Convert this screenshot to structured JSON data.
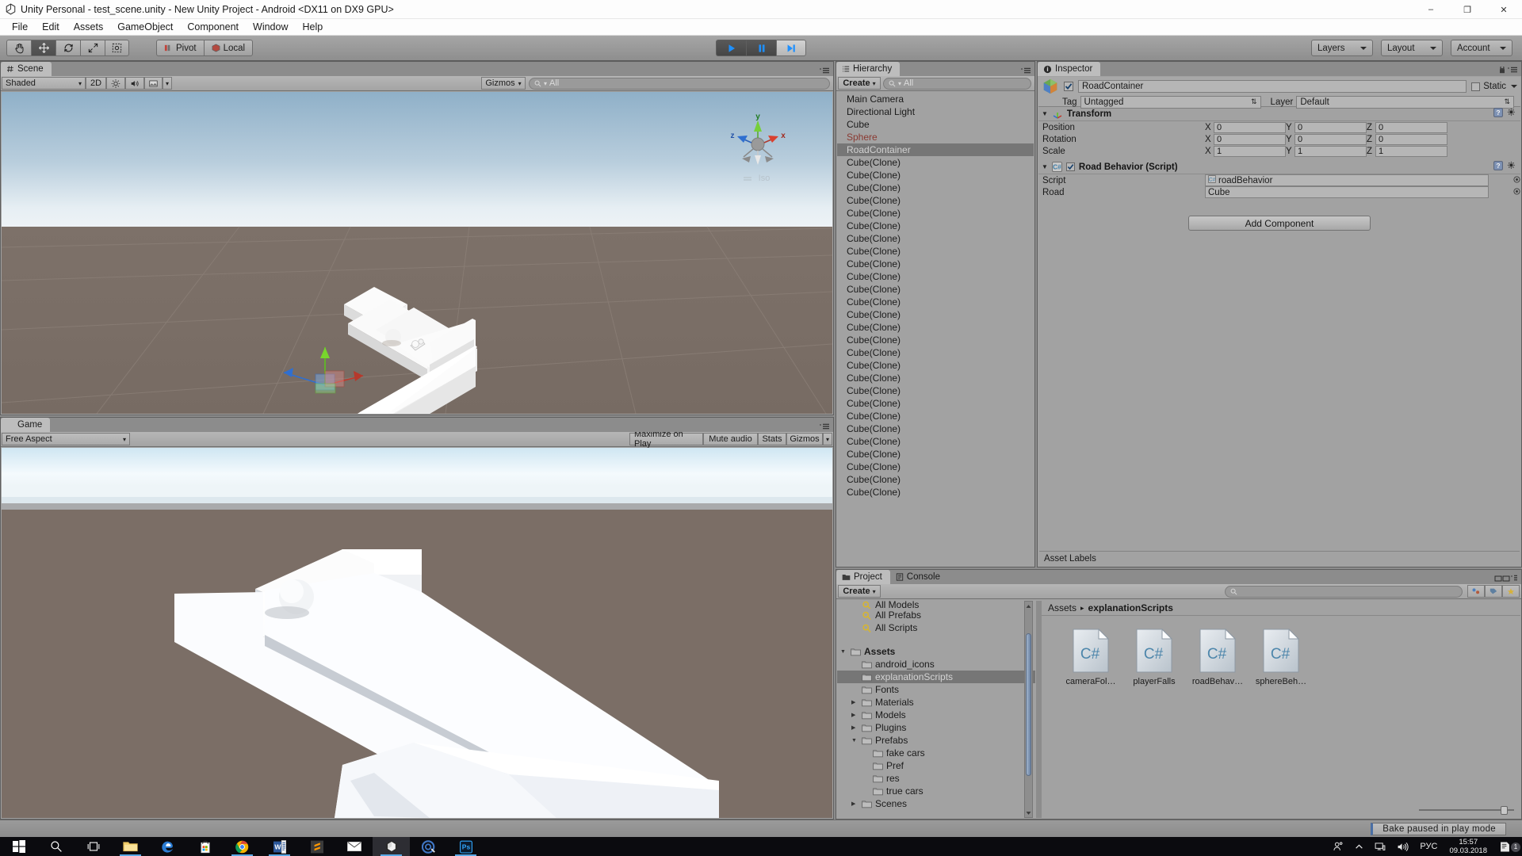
{
  "window": {
    "title": "Unity Personal - test_scene.unity - New Unity Project - Android <DX11 on DX9 GPU>",
    "minimize": "–",
    "maximize": "❐",
    "close": "✕"
  },
  "menu": {
    "items": [
      {
        "label": "File"
      },
      {
        "label": "Edit"
      },
      {
        "label": "Assets"
      },
      {
        "label": "GameObject"
      },
      {
        "label": "Component"
      },
      {
        "label": "Window"
      },
      {
        "label": "Help"
      }
    ]
  },
  "toolbar": {
    "tools": [
      {
        "name": "hand-tool",
        "active": false
      },
      {
        "name": "move-tool",
        "active": true
      },
      {
        "name": "rotate-tool",
        "active": false
      },
      {
        "name": "scale-tool",
        "active": false
      },
      {
        "name": "rect-tool",
        "active": false
      }
    ],
    "pivot_label": "Pivot",
    "local_label": "Local",
    "play_active": true,
    "pause_active": false,
    "step_active": true,
    "layers_label": "Layers",
    "layout_label": "Layout",
    "account_label": "Account"
  },
  "scene": {
    "tab_label": "Scene",
    "shading_mode": "Shaded",
    "mode_2d": "2D",
    "gizmos_label": "Gizmos",
    "search_placeholder": "All",
    "search_value": "All",
    "gizmo": {
      "x_label": "x",
      "y_label": "y",
      "z_label": "z",
      "projection": "Iso"
    }
  },
  "game": {
    "tab_label": "Game",
    "aspect": "Free Aspect",
    "maximize_label": "Maximize on Play",
    "mute_label": "Mute audio",
    "stats_label": "Stats",
    "gizmos_label": "Gizmos"
  },
  "hierarchy": {
    "tab_label": "Hierarchy",
    "create_label": "Create",
    "search_value": "All",
    "items": [
      {
        "label": "Main Camera",
        "state": "normal"
      },
      {
        "label": "Directional Light",
        "state": "normal"
      },
      {
        "label": "Cube",
        "state": "normal"
      },
      {
        "label": "Sphere",
        "state": "missing"
      },
      {
        "label": "RoadContainer",
        "state": "selected"
      },
      {
        "label": "Cube(Clone)",
        "state": "normal"
      },
      {
        "label": "Cube(Clone)",
        "state": "normal"
      },
      {
        "label": "Cube(Clone)",
        "state": "normal"
      },
      {
        "label": "Cube(Clone)",
        "state": "normal"
      },
      {
        "label": "Cube(Clone)",
        "state": "normal"
      },
      {
        "label": "Cube(Clone)",
        "state": "normal"
      },
      {
        "label": "Cube(Clone)",
        "state": "normal"
      },
      {
        "label": "Cube(Clone)",
        "state": "normal"
      },
      {
        "label": "Cube(Clone)",
        "state": "normal"
      },
      {
        "label": "Cube(Clone)",
        "state": "normal"
      },
      {
        "label": "Cube(Clone)",
        "state": "normal"
      },
      {
        "label": "Cube(Clone)",
        "state": "normal"
      },
      {
        "label": "Cube(Clone)",
        "state": "normal"
      },
      {
        "label": "Cube(Clone)",
        "state": "normal"
      },
      {
        "label": "Cube(Clone)",
        "state": "normal"
      },
      {
        "label": "Cube(Clone)",
        "state": "normal"
      },
      {
        "label": "Cube(Clone)",
        "state": "normal"
      },
      {
        "label": "Cube(Clone)",
        "state": "normal"
      },
      {
        "label": "Cube(Clone)",
        "state": "normal"
      },
      {
        "label": "Cube(Clone)",
        "state": "normal"
      },
      {
        "label": "Cube(Clone)",
        "state": "normal"
      },
      {
        "label": "Cube(Clone)",
        "state": "normal"
      },
      {
        "label": "Cube(Clone)",
        "state": "normal"
      },
      {
        "label": "Cube(Clone)",
        "state": "normal"
      },
      {
        "label": "Cube(Clone)",
        "state": "normal"
      },
      {
        "label": "Cube(Clone)",
        "state": "normal"
      },
      {
        "label": "Cube(Clone)",
        "state": "normal"
      }
    ]
  },
  "inspector": {
    "tab_label": "Inspector",
    "object_name": "RoadContainer",
    "enabled": true,
    "static_label": "Static",
    "tag_label": "Tag",
    "tag_value": "Untagged",
    "layer_label": "Layer",
    "layer_value": "Default",
    "transform": {
      "title": "Transform",
      "rows": [
        {
          "label": "Position",
          "x": "0",
          "y": "0",
          "z": "0"
        },
        {
          "label": "Rotation",
          "x": "0",
          "y": "0",
          "z": "0"
        },
        {
          "label": "Scale",
          "x": "1",
          "y": "1",
          "z": "1"
        }
      ],
      "axis_x": "X",
      "axis_y": "Y",
      "axis_z": "Z"
    },
    "script_component": {
      "title": "Road Behavior (Script)",
      "enabled": true,
      "fields": [
        {
          "label": "Script",
          "value": "roadBehavior",
          "kind": "script"
        },
        {
          "label": "Road",
          "value": "Cube",
          "kind": "object"
        }
      ]
    },
    "add_component_label": "Add Component",
    "asset_labels_title": "Asset Labels"
  },
  "project": {
    "tab_label": "Project",
    "console_tab_label": "Console",
    "create_label": "Create",
    "search_value": "",
    "tree": [
      {
        "label": "All Models",
        "indent": 1,
        "type": "search",
        "arrow": "none",
        "selected": false,
        "clipped": true
      },
      {
        "label": "All Prefabs",
        "indent": 1,
        "type": "search",
        "arrow": "none",
        "selected": false
      },
      {
        "label": "All Scripts",
        "indent": 1,
        "type": "search",
        "arrow": "none",
        "selected": false
      },
      {
        "label": "",
        "indent": 0,
        "type": "spacer",
        "arrow": "none",
        "selected": false
      },
      {
        "label": "Assets",
        "indent": 0,
        "type": "folder",
        "arrow": "open",
        "selected": false,
        "bold": true
      },
      {
        "label": "android_icons",
        "indent": 1,
        "type": "folder",
        "arrow": "none",
        "selected": false
      },
      {
        "label": "explanationScripts",
        "indent": 1,
        "type": "folder",
        "arrow": "none",
        "selected": true
      },
      {
        "label": "Fonts",
        "indent": 1,
        "type": "folder",
        "arrow": "none",
        "selected": false
      },
      {
        "label": "Materials",
        "indent": 1,
        "type": "folder",
        "arrow": "closed",
        "selected": false
      },
      {
        "label": "Models",
        "indent": 1,
        "type": "folder",
        "arrow": "closed",
        "selected": false
      },
      {
        "label": "Plugins",
        "indent": 1,
        "type": "folder",
        "arrow": "closed",
        "selected": false
      },
      {
        "label": "Prefabs",
        "indent": 1,
        "type": "folder",
        "arrow": "open",
        "selected": false
      },
      {
        "label": "fake cars",
        "indent": 2,
        "type": "folder",
        "arrow": "none",
        "selected": false
      },
      {
        "label": "Pref",
        "indent": 2,
        "type": "folder",
        "arrow": "none",
        "selected": false
      },
      {
        "label": "res",
        "indent": 2,
        "type": "folder",
        "arrow": "none",
        "selected": false
      },
      {
        "label": "true cars",
        "indent": 2,
        "type": "folder",
        "arrow": "none",
        "selected": false
      },
      {
        "label": "Scenes",
        "indent": 1,
        "type": "folder",
        "arrow": "closed",
        "selected": false
      }
    ],
    "breadcrumb": {
      "root": "Assets",
      "separator": "▸",
      "current": "explanationScripts"
    },
    "assets": [
      {
        "label": "cameraFol…",
        "type": "csharp"
      },
      {
        "label": "playerFalls",
        "type": "csharp"
      },
      {
        "label": "roadBehav…",
        "type": "csharp"
      },
      {
        "label": "sphereBeh…",
        "type": "csharp"
      }
    ]
  },
  "status": {
    "bake_message": "Bake paused in play mode"
  },
  "taskbar": {
    "items": [
      {
        "name": "start-button",
        "glyph": "windows",
        "active": false,
        "running": false
      },
      {
        "name": "search-button",
        "glyph": "search",
        "active": false,
        "running": false
      },
      {
        "name": "task-view-button",
        "glyph": "taskview",
        "active": false,
        "running": false
      },
      {
        "name": "file-explorer",
        "glyph": "folder",
        "active": false,
        "running": true
      },
      {
        "name": "edge-browser",
        "glyph": "edge",
        "active": false,
        "running": false
      },
      {
        "name": "microsoft-store",
        "glyph": "store",
        "active": false,
        "running": false
      },
      {
        "name": "chrome-browser",
        "glyph": "chrome",
        "active": false,
        "running": true
      },
      {
        "name": "word",
        "glyph": "word",
        "active": false,
        "running": true
      },
      {
        "name": "sublime-text",
        "glyph": "sublime",
        "active": false,
        "running": false
      },
      {
        "name": "mail",
        "glyph": "mail",
        "active": false,
        "running": false
      },
      {
        "name": "unity-editor",
        "glyph": "unity",
        "active": true,
        "running": true
      },
      {
        "name": "paint-tool-sai",
        "glyph": "sai",
        "active": false,
        "running": false
      },
      {
        "name": "photoshop",
        "glyph": "ps",
        "active": false,
        "running": true
      }
    ],
    "tray": {
      "people_icon": "people-icon",
      "chevron_icon": "show-hidden-icons",
      "network_icon": "network-icon",
      "volume_icon": "volume-icon",
      "language": "РУС",
      "time": "15:57",
      "date": "09.03.2018",
      "notification_count": "1"
    }
  }
}
